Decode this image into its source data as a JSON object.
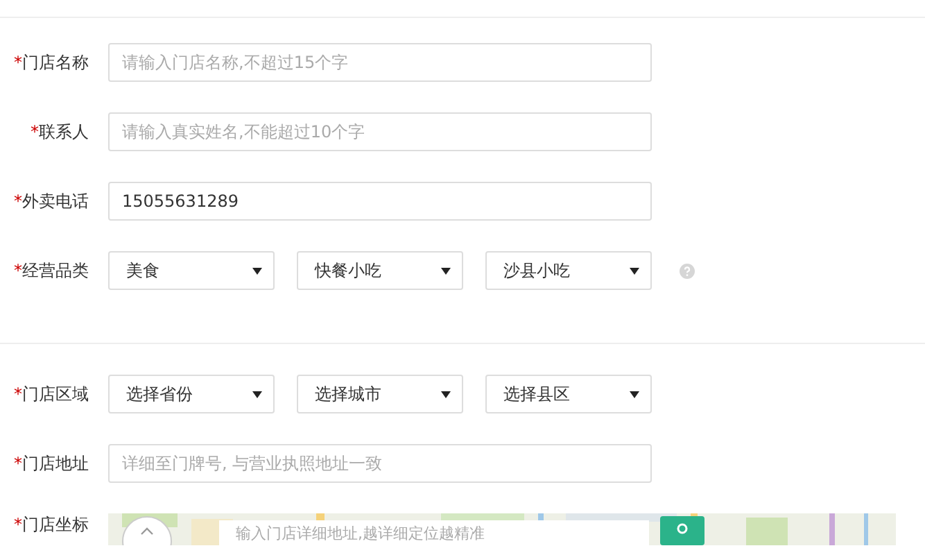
{
  "sections": [
    {
      "rows": [
        {
          "kind": "text",
          "mark": "*",
          "label": "门店名称",
          "placeholder": "请输入门店名称,不超过15个字"
        },
        {
          "kind": "text",
          "mark": "*",
          "label": "联系人",
          "placeholder": "请输入真实姓名,不能超过10个字"
        },
        {
          "kind": "text",
          "mark": "*",
          "label": "外卖电话",
          "value": "15055631289"
        },
        {
          "kind": "selects",
          "mark": "*",
          "label": "经营品类",
          "help": true,
          "selects": [
            "美食",
            "快餐小吃",
            "沙县小吃"
          ]
        }
      ]
    },
    {
      "rows": [
        {
          "kind": "selects",
          "mark": "*",
          "label": "门店区域",
          "selects": [
            "选择省份",
            "选择城市",
            "选择县区"
          ]
        },
        {
          "kind": "text",
          "mark": "*",
          "label": "门店地址",
          "placeholder": "详细至门牌号, 与营业执照地址一致"
        },
        {
          "kind": "map",
          "mark": "*",
          "label": "门店坐标",
          "search_placeholder": "输入门店详细地址,越详细定位越精准"
        }
      ]
    }
  ]
}
